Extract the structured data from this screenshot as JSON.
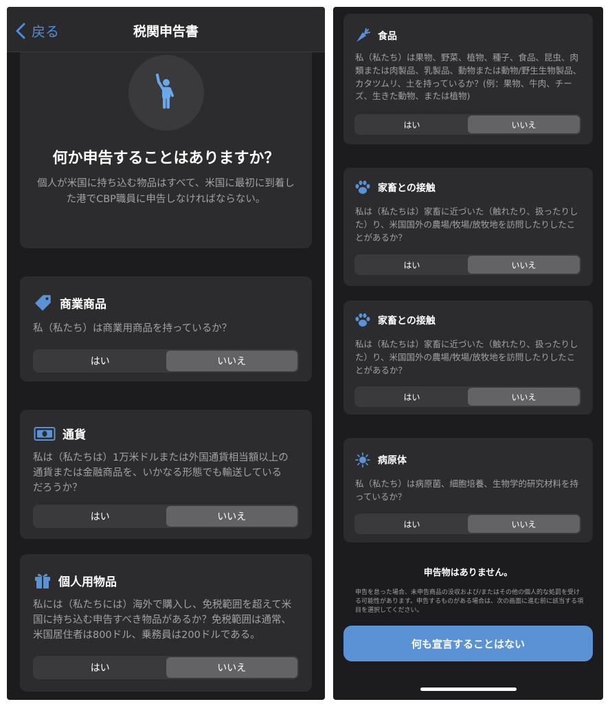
{
  "colors": {
    "accent": "#4a8fe0",
    "background": "#1c1c1e",
    "card": "#2c2c2e",
    "button": "#5b92d6"
  },
  "nav": {
    "back_label": "戻る",
    "title": "税関申告書"
  },
  "hero": {
    "title": "何か申告することはありますか？",
    "description": "個人が米国に持ち込む物品はすべて、米国に最初に到着した港でCBP職員に申告しなければならない。"
  },
  "segment": {
    "yes": "はい",
    "no": "いいえ"
  },
  "left_cards": [
    {
      "icon": "tag-icon",
      "title": "商業商品",
      "question": "私（私たち）は商業用商品を持っているか？",
      "selected": "いいえ"
    },
    {
      "icon": "banknote-icon",
      "title": "通貨",
      "question": "私は（私たちは）1万米ドルまたは外国通貨相当額以上の通貨または金融商品を、いかなる形態でも輸送しているだろうか？",
      "selected": "いいえ"
    },
    {
      "icon": "gift-icon",
      "title": "個人用物品",
      "question": "私には（私たちには）海外で購入し、免税範囲を超えて米国に持ち込む申告すべき物品があるか？免税範囲は通常、米国居住者は800ドル、乗務員は200ドルである。",
      "selected": "いいえ"
    }
  ],
  "right_cards": [
    {
      "icon": "carrot-icon",
      "title": "食品",
      "question": "私（私たち）は果物、野菜、植物、種子、食品、昆虫、肉類または肉製品、乳製品、動物または動物/野生生物製品、カタツムリ、土を持っているか？(例：果物、牛肉、チーズ、生きた動物、または植物)",
      "selected": "いいえ"
    },
    {
      "icon": "paw-icon",
      "title": "家畜との接触",
      "question": "私は（私たちは）家畜に近づいた（触れたり、扱ったりした）り、米国国外の農場/牧場/放牧地を訪問したりしたことがあるか？",
      "selected": "いいえ"
    },
    {
      "icon": "paw-icon",
      "title": "家畜との接触",
      "question": "私は（私たちは）家畜に近づいた（触れたり、扱ったりした）り、米国国外の農場/牧場/放牧地を訪問したりしたことがあるか？",
      "selected": "いいえ"
    },
    {
      "icon": "virus-icon",
      "title": "病原体",
      "question": "私（私たち）は病原菌、細胞培養、生物学的研究材料を持っているか？",
      "selected": "いいえ"
    }
  ],
  "footer": {
    "title": "申告物はありません。",
    "note": "申告を怠った場合、未申告商品の没収および/またはその他の個人的な処罰を受ける可能性があります。申告するものがある場合は、次の画面に進む前に該当する項目を選択してください。",
    "button_label": "何も宣言することはない"
  }
}
